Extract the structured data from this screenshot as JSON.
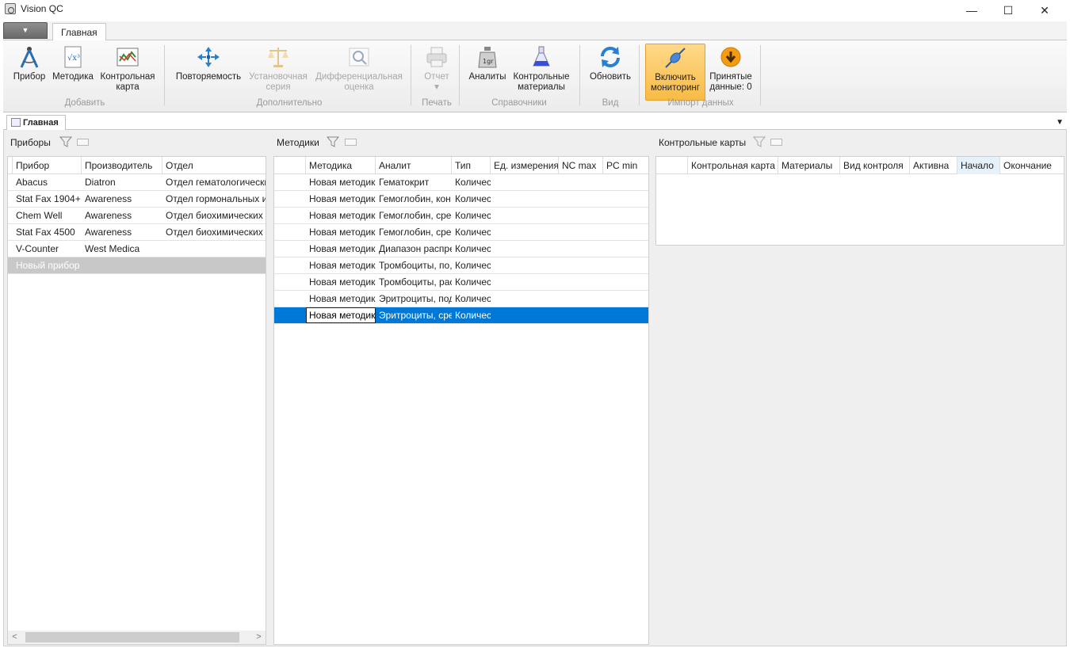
{
  "window": {
    "title": "Vision QC",
    "minimize": "—",
    "maximize": "☐",
    "close": "✕"
  },
  "ribbon_tabs": {
    "app_menu": "▼",
    "main_tab": "Главная"
  },
  "ribbon": {
    "add": {
      "label": "Добавить",
      "device": "Прибор",
      "method": "Методика",
      "chart_l1": "Контрольная",
      "chart_l2": "карта"
    },
    "extra": {
      "label": "Дополнительно",
      "repeat": "Повторяемость",
      "setup_l1": "Установочная",
      "setup_l2": "серия",
      "diff_l1": "Дифференциальная",
      "diff_l2": "оценка"
    },
    "print": {
      "label": "Печать",
      "report": "Отчет",
      "report_dd": "▾"
    },
    "refs": {
      "label": "Справочники",
      "analytes": "Аналиты",
      "materials_l1": "Контрольные",
      "materials_l2": "материалы"
    },
    "view": {
      "label": "Вид",
      "refresh": "Обновить"
    },
    "import": {
      "label": "Импорт данных",
      "monitor_l1": "Включить",
      "monitor_l2": "мониторинг",
      "received_l1": "Принятые",
      "received_l2": "данные: 0"
    },
    "colors": {
      "active_bg": "#f9bb45",
      "blue_icon": "#2a80d0",
      "orange_icon": "#f39c12"
    }
  },
  "doc_tab": {
    "label": "Главная",
    "dropdown": "▼"
  },
  "devices": {
    "title": "Приборы",
    "columns": [
      "Прибор",
      "Производитель",
      "Отдел"
    ],
    "rows": [
      [
        "Abacus",
        "Diatron",
        "Отдел гематологических"
      ],
      [
        "Stat Fax 1904+",
        "Awareness",
        "Отдел гормональных и"
      ],
      [
        "Chem Well",
        "Awareness",
        "Отдел биохимических"
      ],
      [
        "Stat Fax 4500",
        "Awareness",
        "Отдел биохимических"
      ],
      [
        "V-Counter",
        "West Medica",
        ""
      ]
    ],
    "new_row": "Новый прибор",
    "scroll_left": "<",
    "scroll_right": ">"
  },
  "methods": {
    "title": "Методики",
    "columns": [
      "Методика",
      "Аналит",
      "Тип",
      "Ед. измерения",
      "NC max",
      "PC min"
    ],
    "rows": [
      [
        "Новая методик",
        "Гематокрит",
        "Количес"
      ],
      [
        "Новая методик",
        "Гемоглобин, кон",
        "Количес"
      ],
      [
        "Новая методик",
        "Гемоглобин, сре",
        "Количес"
      ],
      [
        "Новая методик",
        "Гемоглобин, сре",
        "Количес"
      ],
      [
        "Новая методик",
        "Диапазон распре",
        "Количес"
      ],
      [
        "Новая методик",
        "Тромбоциты, по,",
        "Количес"
      ],
      [
        "Новая методик",
        "Тромбоциты, рас",
        "Количес"
      ],
      [
        "Новая методик",
        "Эритроциты, под",
        "Количес"
      ],
      [
        "Новая методик",
        "Эритроциты, сре",
        "Количес"
      ]
    ],
    "selected_index": 8
  },
  "charts": {
    "title": "Контрольные карты",
    "columns": [
      "Контрольная карта",
      "Материалы",
      "Вид контроля",
      "Активна",
      "Начало",
      "Окончание"
    ],
    "sorted_column": "Начало"
  }
}
